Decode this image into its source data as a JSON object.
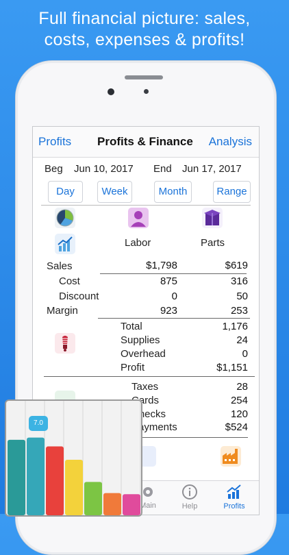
{
  "headline": {
    "line1": "Full financial picture: sales,",
    "line2": "costs, expenses & profits!"
  },
  "nav": {
    "back": "Profits",
    "title": "Profits & Finance",
    "analysis": "Analysis"
  },
  "dates": {
    "beg_label": "Beg",
    "beg_value": "Jun 10, 2017",
    "end_label": "End",
    "end_value": "Jun 17, 2017"
  },
  "range_buttons": [
    "Day",
    "Week",
    "Month",
    "Range"
  ],
  "columns": {
    "labor": "Labor",
    "parts": "Parts"
  },
  "rows": {
    "sales": {
      "label": "Sales",
      "labor": "$1,798",
      "parts": "$619"
    },
    "cost": {
      "label": "Cost",
      "labor": "875",
      "parts": "316"
    },
    "discount": {
      "label": "Discount",
      "labor": "0",
      "parts": "50"
    },
    "margin": {
      "label": "Margin",
      "labor": "923",
      "parts": "253"
    }
  },
  "expenses": {
    "total": {
      "label": "Total",
      "value": "1,176"
    },
    "supplies": {
      "label": "Supplies",
      "value": "24"
    },
    "overhead": {
      "label": "Overhead",
      "value": "0"
    },
    "profit": {
      "label": "Profit",
      "value": "$1,151"
    }
  },
  "finance": {
    "taxes": {
      "label": "Taxes",
      "value": "28"
    },
    "cards": {
      "label": "Cards",
      "value": "254"
    },
    "checks": {
      "label": "Checks",
      "value": "120"
    },
    "payments": {
      "label": "Payments",
      "value": "$524"
    }
  },
  "tabs": {
    "main": "Main",
    "help": "Help",
    "profits": "Profits"
  },
  "chart_overlay": {
    "badge": "7.0",
    "bars": [
      {
        "value": 6.8,
        "color": "#2a9a98"
      },
      {
        "value": 7.0,
        "color": "#35a7b8"
      },
      {
        "value": 6.2,
        "color": "#e8413c"
      },
      {
        "value": 5.0,
        "color": "#f3d23b"
      },
      {
        "value": 3.0,
        "color": "#7cc544"
      },
      {
        "value": 2.0,
        "color": "#f07a3a"
      },
      {
        "value": 1.9,
        "color": "#e04b9c"
      }
    ],
    "max": 10
  },
  "colors": {
    "background": "#2a8aec",
    "link": "#1a73d9",
    "tab_active": "#1a73d9",
    "tab_inactive": "#8e8e93"
  }
}
